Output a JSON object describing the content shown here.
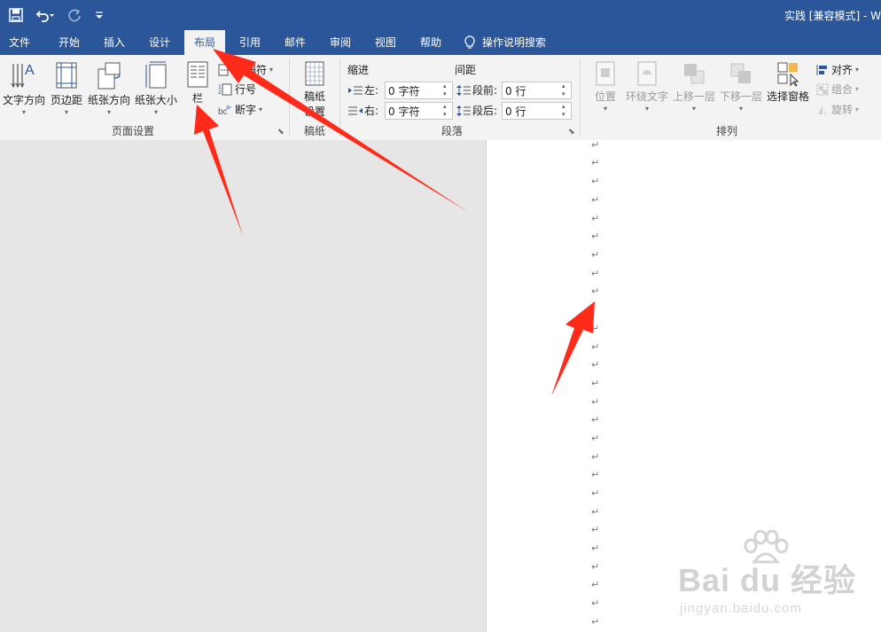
{
  "titlebar": {
    "title": "实践 [兼容模式] - W"
  },
  "tabs": [
    {
      "label": "文件"
    },
    {
      "label": "开始"
    },
    {
      "label": "插入"
    },
    {
      "label": "设计"
    },
    {
      "label": "布局"
    },
    {
      "label": "引用"
    },
    {
      "label": "邮件"
    },
    {
      "label": "审阅"
    },
    {
      "label": "视图"
    },
    {
      "label": "帮助"
    },
    {
      "label": "操作说明搜索"
    }
  ],
  "ribbon": {
    "page_setup": {
      "label": "页面设置",
      "text_direction": "文字方向",
      "margins": "页边距",
      "orientation": "纸张方向",
      "size": "纸张大小",
      "columns": "栏",
      "breaks": "分隔符",
      "line_numbers": "行号",
      "hyphenation": "断字"
    },
    "manuscript": {
      "label": "稿纸",
      "settings_line1": "稿纸",
      "settings_line2": "设置"
    },
    "paragraph": {
      "label": "段落",
      "indent_title": "缩进",
      "spacing_title": "间距",
      "left_label": "左:",
      "left_value": "0 字符",
      "right_label": "右:",
      "right_value": "0 字符",
      "before_label": "段前:",
      "before_value": "0 行",
      "after_label": "段后:",
      "after_value": "0 行"
    },
    "arrange": {
      "label": "排列",
      "position": "位置",
      "wrap_text": "环绕文字",
      "bring_forward": "上移一层",
      "send_backward": "下移一层",
      "selection_pane": "选择窗格",
      "align": "对齐",
      "group": "组合",
      "rotate": "旋转"
    }
  },
  "document": {
    "paragraph_mark": "↵"
  },
  "watermark": {
    "main": "Bai du 经验",
    "sub": "jingyan.baidu.com"
  },
  "colors": {
    "titlebar": "#2b579a",
    "ribbon": "#f3f3f3",
    "annotation_arrow": "#ff2a1a"
  }
}
